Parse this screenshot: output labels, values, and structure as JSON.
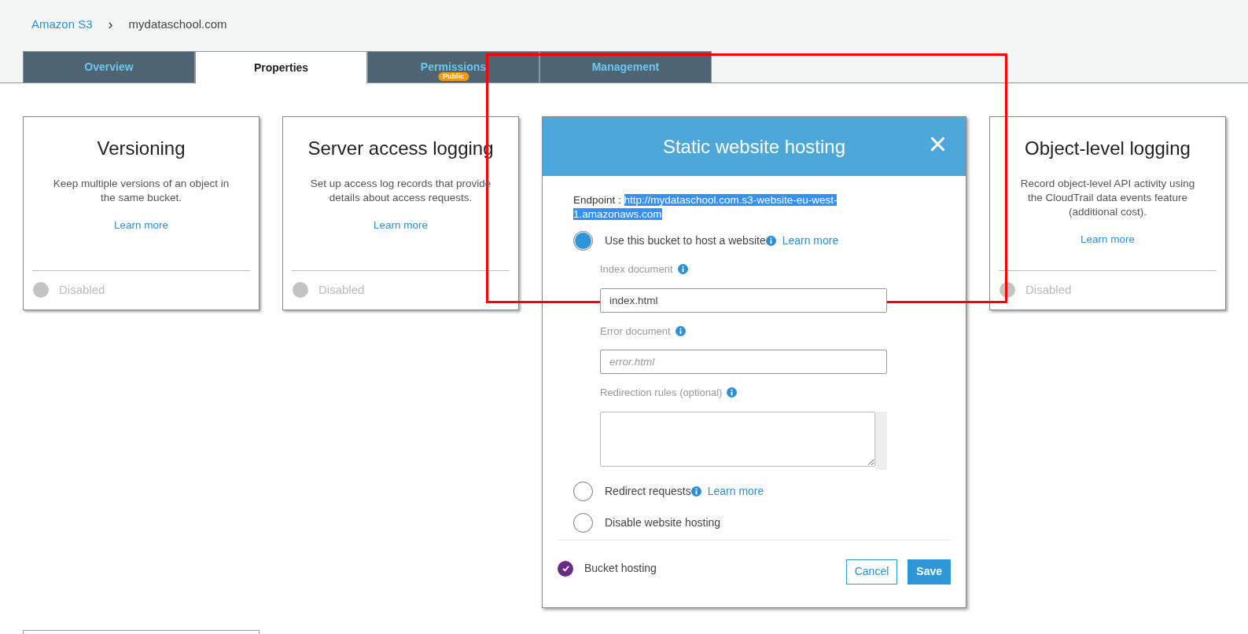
{
  "breadcrumb": [
    {
      "text": "Amazon S3",
      "kind": "link"
    },
    {
      "text": "›",
      "kind": "separator"
    },
    {
      "text": "mydataschool.com",
      "kind": "current"
    }
  ],
  "tabs": [
    {
      "label": "Overview",
      "selected": false
    },
    {
      "label": "Properties",
      "selected": true
    },
    {
      "label": "Permissions",
      "selected": false,
      "badge": "Public"
    },
    {
      "label": "Management",
      "selected": false
    }
  ],
  "cards": [
    {
      "title": "Versioning",
      "description": "Keep multiple versions of an object in the same bucket.",
      "link": "Learn more",
      "status": "Disabled",
      "enabled": false
    },
    {
      "title": "Server access logging",
      "description": "Set up access log records that provide details about access requests.",
      "link": "Learn more",
      "status": "Disabled",
      "enabled": false
    },
    {
      "title": "Object-level logging",
      "description": "Record object-level API activity using the CloudTrail data events feature (additional cost).",
      "link": "Learn more",
      "status": "Disabled",
      "enabled": false
    }
  ],
  "dialog": {
    "title": "Static website hosting",
    "close": "×",
    "endpoint_label": "Endpoint :",
    "endpoint_url": "http://mydataschool.com.s3-website-eu-west-1.amazonaws.com",
    "endpoint_selected": true,
    "options": [
      {
        "label": "Use this bucket to host a website",
        "selected": true,
        "info": true,
        "link": "Learn more"
      },
      {
        "label": "Redirect requests",
        "selected": false,
        "info": true,
        "link": "Learn more"
      },
      {
        "label": "Disable website hosting",
        "selected": false,
        "info": false
      }
    ],
    "fields": [
      {
        "kind": "input",
        "label": "Index document",
        "value": "index.html"
      },
      {
        "kind": "input",
        "label": "Error document",
        "placeholder": "error.html"
      },
      {
        "kind": "textarea",
        "label": "Redirection rules (optional)"
      }
    ],
    "status": {
      "label": "Bucket hosting",
      "checked": true
    },
    "buttons": [
      {
        "label": "Cancel",
        "kind": "secondary"
      },
      {
        "label": "Save",
        "kind": "primary"
      }
    ]
  },
  "annotations": [
    {
      "kind": "rectangle"
    }
  ]
}
